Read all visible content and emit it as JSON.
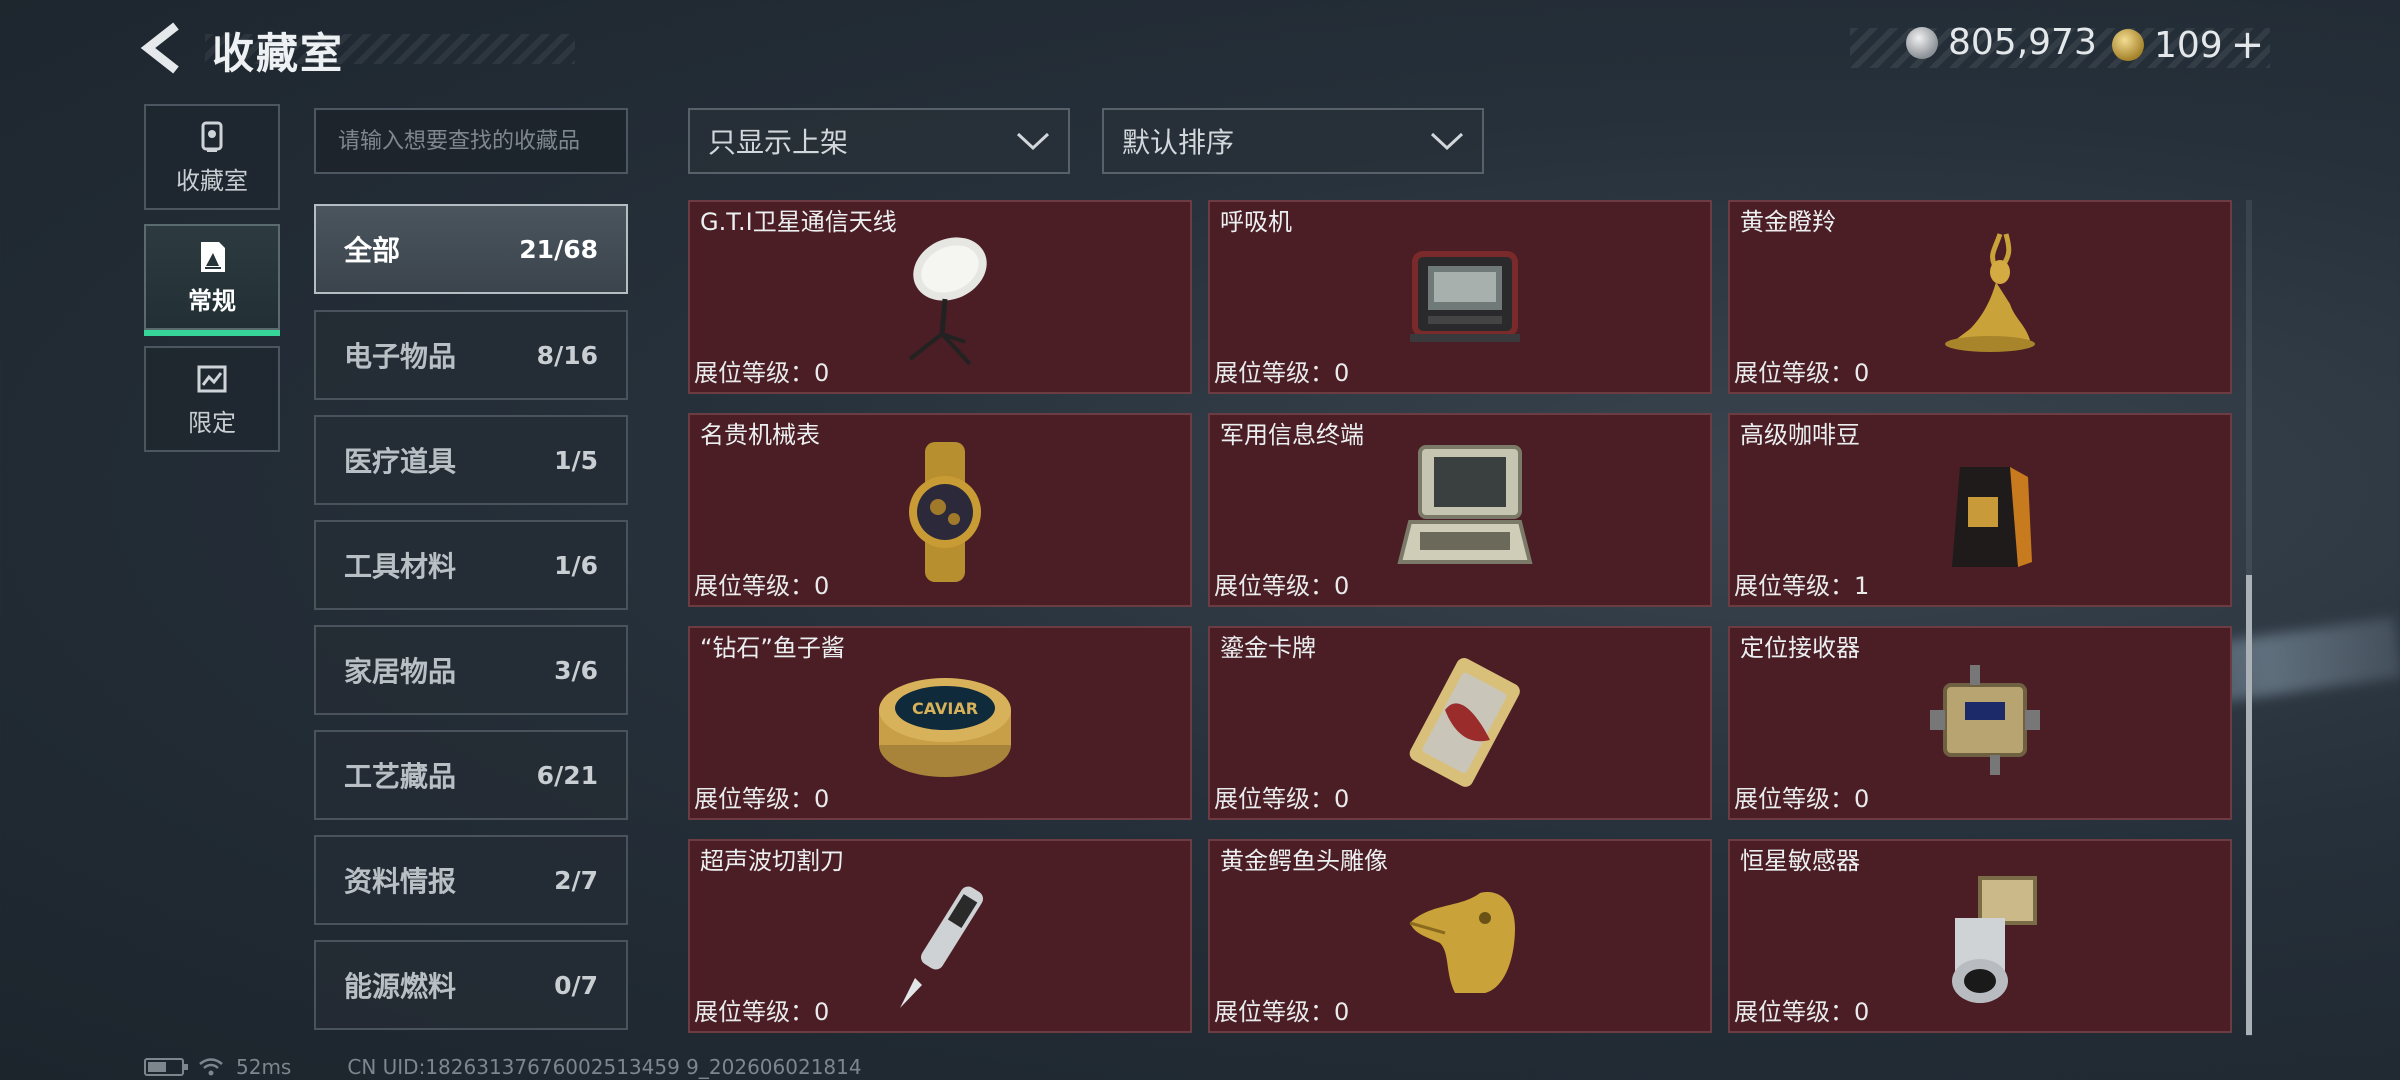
{
  "header": {
    "title": "收藏室",
    "currencies": [
      {
        "icon": "silver-coin-icon",
        "value": "805,973"
      },
      {
        "icon": "gold-coin-icon",
        "value": "109"
      }
    ],
    "plus": "+"
  },
  "mode_tabs": [
    {
      "label": "收藏室",
      "icon": "collection-room-icon",
      "active": false
    },
    {
      "label": "常规",
      "icon": "regular-icon",
      "active": true
    },
    {
      "label": "限定",
      "icon": "limited-icon",
      "active": false
    }
  ],
  "search": {
    "placeholder": "请输入想要查找的收藏品"
  },
  "categories": [
    {
      "name": "全部",
      "count": "21/68",
      "active": true
    },
    {
      "name": "电子物品",
      "count": "8/16"
    },
    {
      "name": "医疗道具",
      "count": "1/5"
    },
    {
      "name": "工具材料",
      "count": "1/6"
    },
    {
      "name": "家居物品",
      "count": "3/6"
    },
    {
      "name": "工艺藏品",
      "count": "6/21"
    },
    {
      "name": "资料情报",
      "count": "2/7"
    },
    {
      "name": "能源燃料",
      "count": "0/7"
    }
  ],
  "filters": {
    "display_filter": "只显示上架",
    "sort": "默认排序"
  },
  "level_label": "展位等级：",
  "items": [
    {
      "name": "G.T.I卫星通信天线",
      "level": "0",
      "icon": "satellite-dish-icon"
    },
    {
      "name": "呼吸机",
      "level": "0",
      "icon": "ventilator-icon"
    },
    {
      "name": "黄金瞪羚",
      "level": "0",
      "icon": "golden-gazelle-icon"
    },
    {
      "name": "名贵机械表",
      "level": "0",
      "icon": "luxury-watch-icon"
    },
    {
      "name": "军用信息终端",
      "level": "0",
      "icon": "military-terminal-icon"
    },
    {
      "name": "高级咖啡豆",
      "level": "1",
      "icon": "coffee-beans-icon"
    },
    {
      "name": "“钻石”鱼子酱",
      "level": "0",
      "icon": "caviar-tin-icon",
      "label": "CAVIAR"
    },
    {
      "name": "鎏金卡牌",
      "level": "0",
      "icon": "gilded-card-icon"
    },
    {
      "name": "定位接收器",
      "level": "0",
      "icon": "positioning-receiver-icon"
    },
    {
      "name": "超声波切割刀",
      "level": "0",
      "icon": "ultrasonic-cutter-icon"
    },
    {
      "name": "黄金鳄鱼头雕像",
      "level": "0",
      "icon": "gold-crocodile-head-icon"
    },
    {
      "name": "恒星敏感器",
      "level": "0",
      "icon": "star-sensor-icon"
    }
  ],
  "footer": {
    "ping": "52ms",
    "uid": "CN UID:18263137676002513459 9_202606021814"
  },
  "colors": {
    "accent_green": "#37d49a",
    "card_bg": "#4a1e24",
    "card_border": "#6d3c42"
  }
}
